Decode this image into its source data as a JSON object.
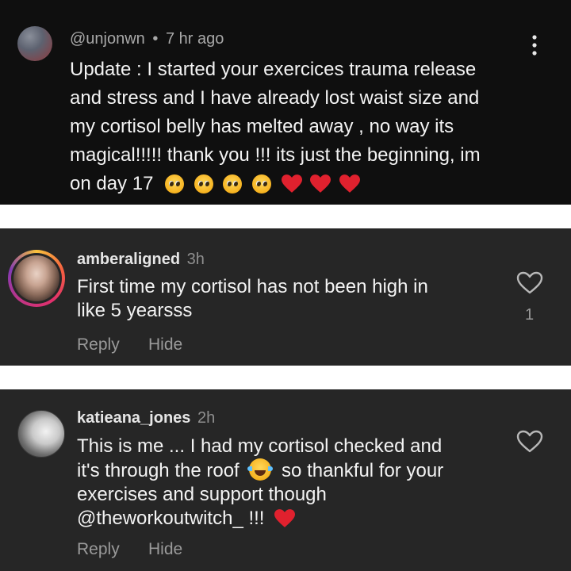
{
  "comment1": {
    "handle": "@unjonwn",
    "dot": "•",
    "time": "7 hr ago",
    "lines": [
      "Update : I started your exercices trauma release",
      "and stress and I have already lost waist size and",
      "my cortisol belly has melted away , no way its",
      "magical!!!!! thank you !!! its just the beginning, im",
      "on day 17"
    ],
    "emoji": [
      "pleading-face-icon",
      "pleading-face-icon",
      "pleading-face-icon",
      "pleading-face-icon",
      "red-heart-icon",
      "red-heart-icon",
      "red-heart-icon"
    ]
  },
  "comment2": {
    "username": "amberaligned",
    "time": "3h",
    "lines": [
      "First time my cortisol has not been high in",
      "like 5 yearsss"
    ],
    "like_count": "1",
    "reply_label": "Reply",
    "hide_label": "Hide"
  },
  "comment3": {
    "username": "katieana_jones",
    "time": "2h",
    "line1": "This is me ... I had my cortisol checked and",
    "line2_a": "it's through the roof",
    "line2_b": "so thankful for your",
    "line3": "exercises and support though",
    "line4": "@theworkoutwitch_ !!!",
    "reply_label": "Reply",
    "hide_label": "Hide"
  },
  "colors": {
    "dark_panel": "#0f0f0f",
    "grey_panel": "#262626",
    "heart_red": "#e0212e"
  }
}
